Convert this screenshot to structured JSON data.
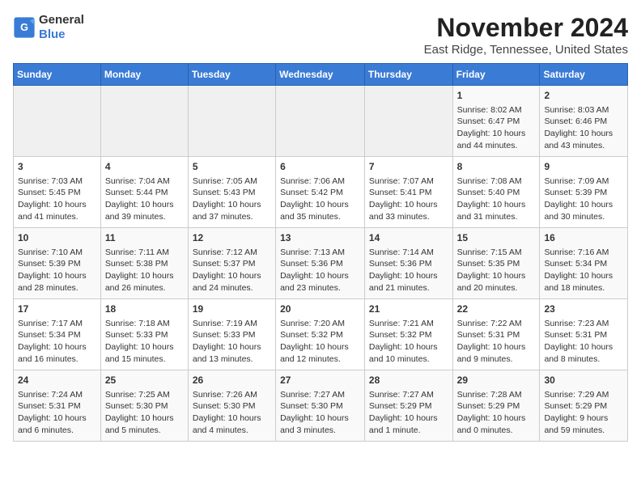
{
  "logo": {
    "general": "General",
    "blue": "Blue"
  },
  "title": "November 2024",
  "location": "East Ridge, Tennessee, United States",
  "days_header": [
    "Sunday",
    "Monday",
    "Tuesday",
    "Wednesday",
    "Thursday",
    "Friday",
    "Saturday"
  ],
  "weeks": [
    [
      {
        "num": "",
        "info": ""
      },
      {
        "num": "",
        "info": ""
      },
      {
        "num": "",
        "info": ""
      },
      {
        "num": "",
        "info": ""
      },
      {
        "num": "",
        "info": ""
      },
      {
        "num": "1",
        "info": "Sunrise: 8:02 AM\nSunset: 6:47 PM\nDaylight: 10 hours and 44 minutes."
      },
      {
        "num": "2",
        "info": "Sunrise: 8:03 AM\nSunset: 6:46 PM\nDaylight: 10 hours and 43 minutes."
      }
    ],
    [
      {
        "num": "3",
        "info": "Sunrise: 7:03 AM\nSunset: 5:45 PM\nDaylight: 10 hours and 41 minutes."
      },
      {
        "num": "4",
        "info": "Sunrise: 7:04 AM\nSunset: 5:44 PM\nDaylight: 10 hours and 39 minutes."
      },
      {
        "num": "5",
        "info": "Sunrise: 7:05 AM\nSunset: 5:43 PM\nDaylight: 10 hours and 37 minutes."
      },
      {
        "num": "6",
        "info": "Sunrise: 7:06 AM\nSunset: 5:42 PM\nDaylight: 10 hours and 35 minutes."
      },
      {
        "num": "7",
        "info": "Sunrise: 7:07 AM\nSunset: 5:41 PM\nDaylight: 10 hours and 33 minutes."
      },
      {
        "num": "8",
        "info": "Sunrise: 7:08 AM\nSunset: 5:40 PM\nDaylight: 10 hours and 31 minutes."
      },
      {
        "num": "9",
        "info": "Sunrise: 7:09 AM\nSunset: 5:39 PM\nDaylight: 10 hours and 30 minutes."
      }
    ],
    [
      {
        "num": "10",
        "info": "Sunrise: 7:10 AM\nSunset: 5:39 PM\nDaylight: 10 hours and 28 minutes."
      },
      {
        "num": "11",
        "info": "Sunrise: 7:11 AM\nSunset: 5:38 PM\nDaylight: 10 hours and 26 minutes."
      },
      {
        "num": "12",
        "info": "Sunrise: 7:12 AM\nSunset: 5:37 PM\nDaylight: 10 hours and 24 minutes."
      },
      {
        "num": "13",
        "info": "Sunrise: 7:13 AM\nSunset: 5:36 PM\nDaylight: 10 hours and 23 minutes."
      },
      {
        "num": "14",
        "info": "Sunrise: 7:14 AM\nSunset: 5:36 PM\nDaylight: 10 hours and 21 minutes."
      },
      {
        "num": "15",
        "info": "Sunrise: 7:15 AM\nSunset: 5:35 PM\nDaylight: 10 hours and 20 minutes."
      },
      {
        "num": "16",
        "info": "Sunrise: 7:16 AM\nSunset: 5:34 PM\nDaylight: 10 hours and 18 minutes."
      }
    ],
    [
      {
        "num": "17",
        "info": "Sunrise: 7:17 AM\nSunset: 5:34 PM\nDaylight: 10 hours and 16 minutes."
      },
      {
        "num": "18",
        "info": "Sunrise: 7:18 AM\nSunset: 5:33 PM\nDaylight: 10 hours and 15 minutes."
      },
      {
        "num": "19",
        "info": "Sunrise: 7:19 AM\nSunset: 5:33 PM\nDaylight: 10 hours and 13 minutes."
      },
      {
        "num": "20",
        "info": "Sunrise: 7:20 AM\nSunset: 5:32 PM\nDaylight: 10 hours and 12 minutes."
      },
      {
        "num": "21",
        "info": "Sunrise: 7:21 AM\nSunset: 5:32 PM\nDaylight: 10 hours and 10 minutes."
      },
      {
        "num": "22",
        "info": "Sunrise: 7:22 AM\nSunset: 5:31 PM\nDaylight: 10 hours and 9 minutes."
      },
      {
        "num": "23",
        "info": "Sunrise: 7:23 AM\nSunset: 5:31 PM\nDaylight: 10 hours and 8 minutes."
      }
    ],
    [
      {
        "num": "24",
        "info": "Sunrise: 7:24 AM\nSunset: 5:31 PM\nDaylight: 10 hours and 6 minutes."
      },
      {
        "num": "25",
        "info": "Sunrise: 7:25 AM\nSunset: 5:30 PM\nDaylight: 10 hours and 5 minutes."
      },
      {
        "num": "26",
        "info": "Sunrise: 7:26 AM\nSunset: 5:30 PM\nDaylight: 10 hours and 4 minutes."
      },
      {
        "num": "27",
        "info": "Sunrise: 7:27 AM\nSunset: 5:30 PM\nDaylight: 10 hours and 3 minutes."
      },
      {
        "num": "28",
        "info": "Sunrise: 7:27 AM\nSunset: 5:29 PM\nDaylight: 10 hours and 1 minute."
      },
      {
        "num": "29",
        "info": "Sunrise: 7:28 AM\nSunset: 5:29 PM\nDaylight: 10 hours and 0 minutes."
      },
      {
        "num": "30",
        "info": "Sunrise: 7:29 AM\nSunset: 5:29 PM\nDaylight: 9 hours and 59 minutes."
      }
    ]
  ]
}
